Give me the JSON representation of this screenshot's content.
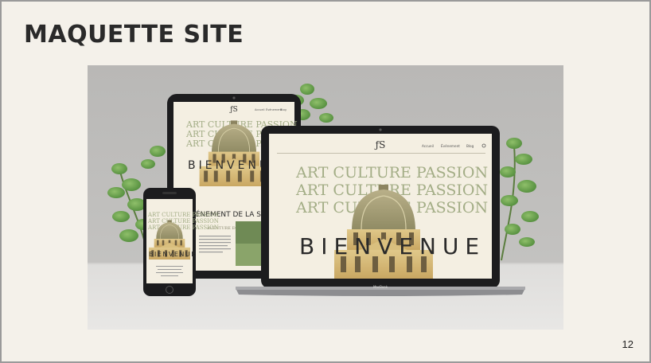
{
  "slide": {
    "title": "MAQUETTE SITE",
    "page_number": "12"
  },
  "mockup": {
    "logo": "ƒS",
    "nav": [
      "Accueil",
      "Événement",
      "Blog"
    ],
    "hero_lines": [
      "ART CULTURE PASSION",
      "ART CULTURE PASSION",
      "ART CULTURE PASSION"
    ],
    "hero_word": "BIENVENUE",
    "tablet_section_title": "ÉVÉNEMENT DE LA SEMAINE",
    "tablet_section_sub": "AVENTURE ECLAIRÉE",
    "laptop_brand": "MacBook"
  },
  "colors": {
    "hero_green": "#a3ad86",
    "page_bg": "#f4f1ea",
    "device_black": "#1c1c1e",
    "title_dark": "#2a2a2a"
  }
}
